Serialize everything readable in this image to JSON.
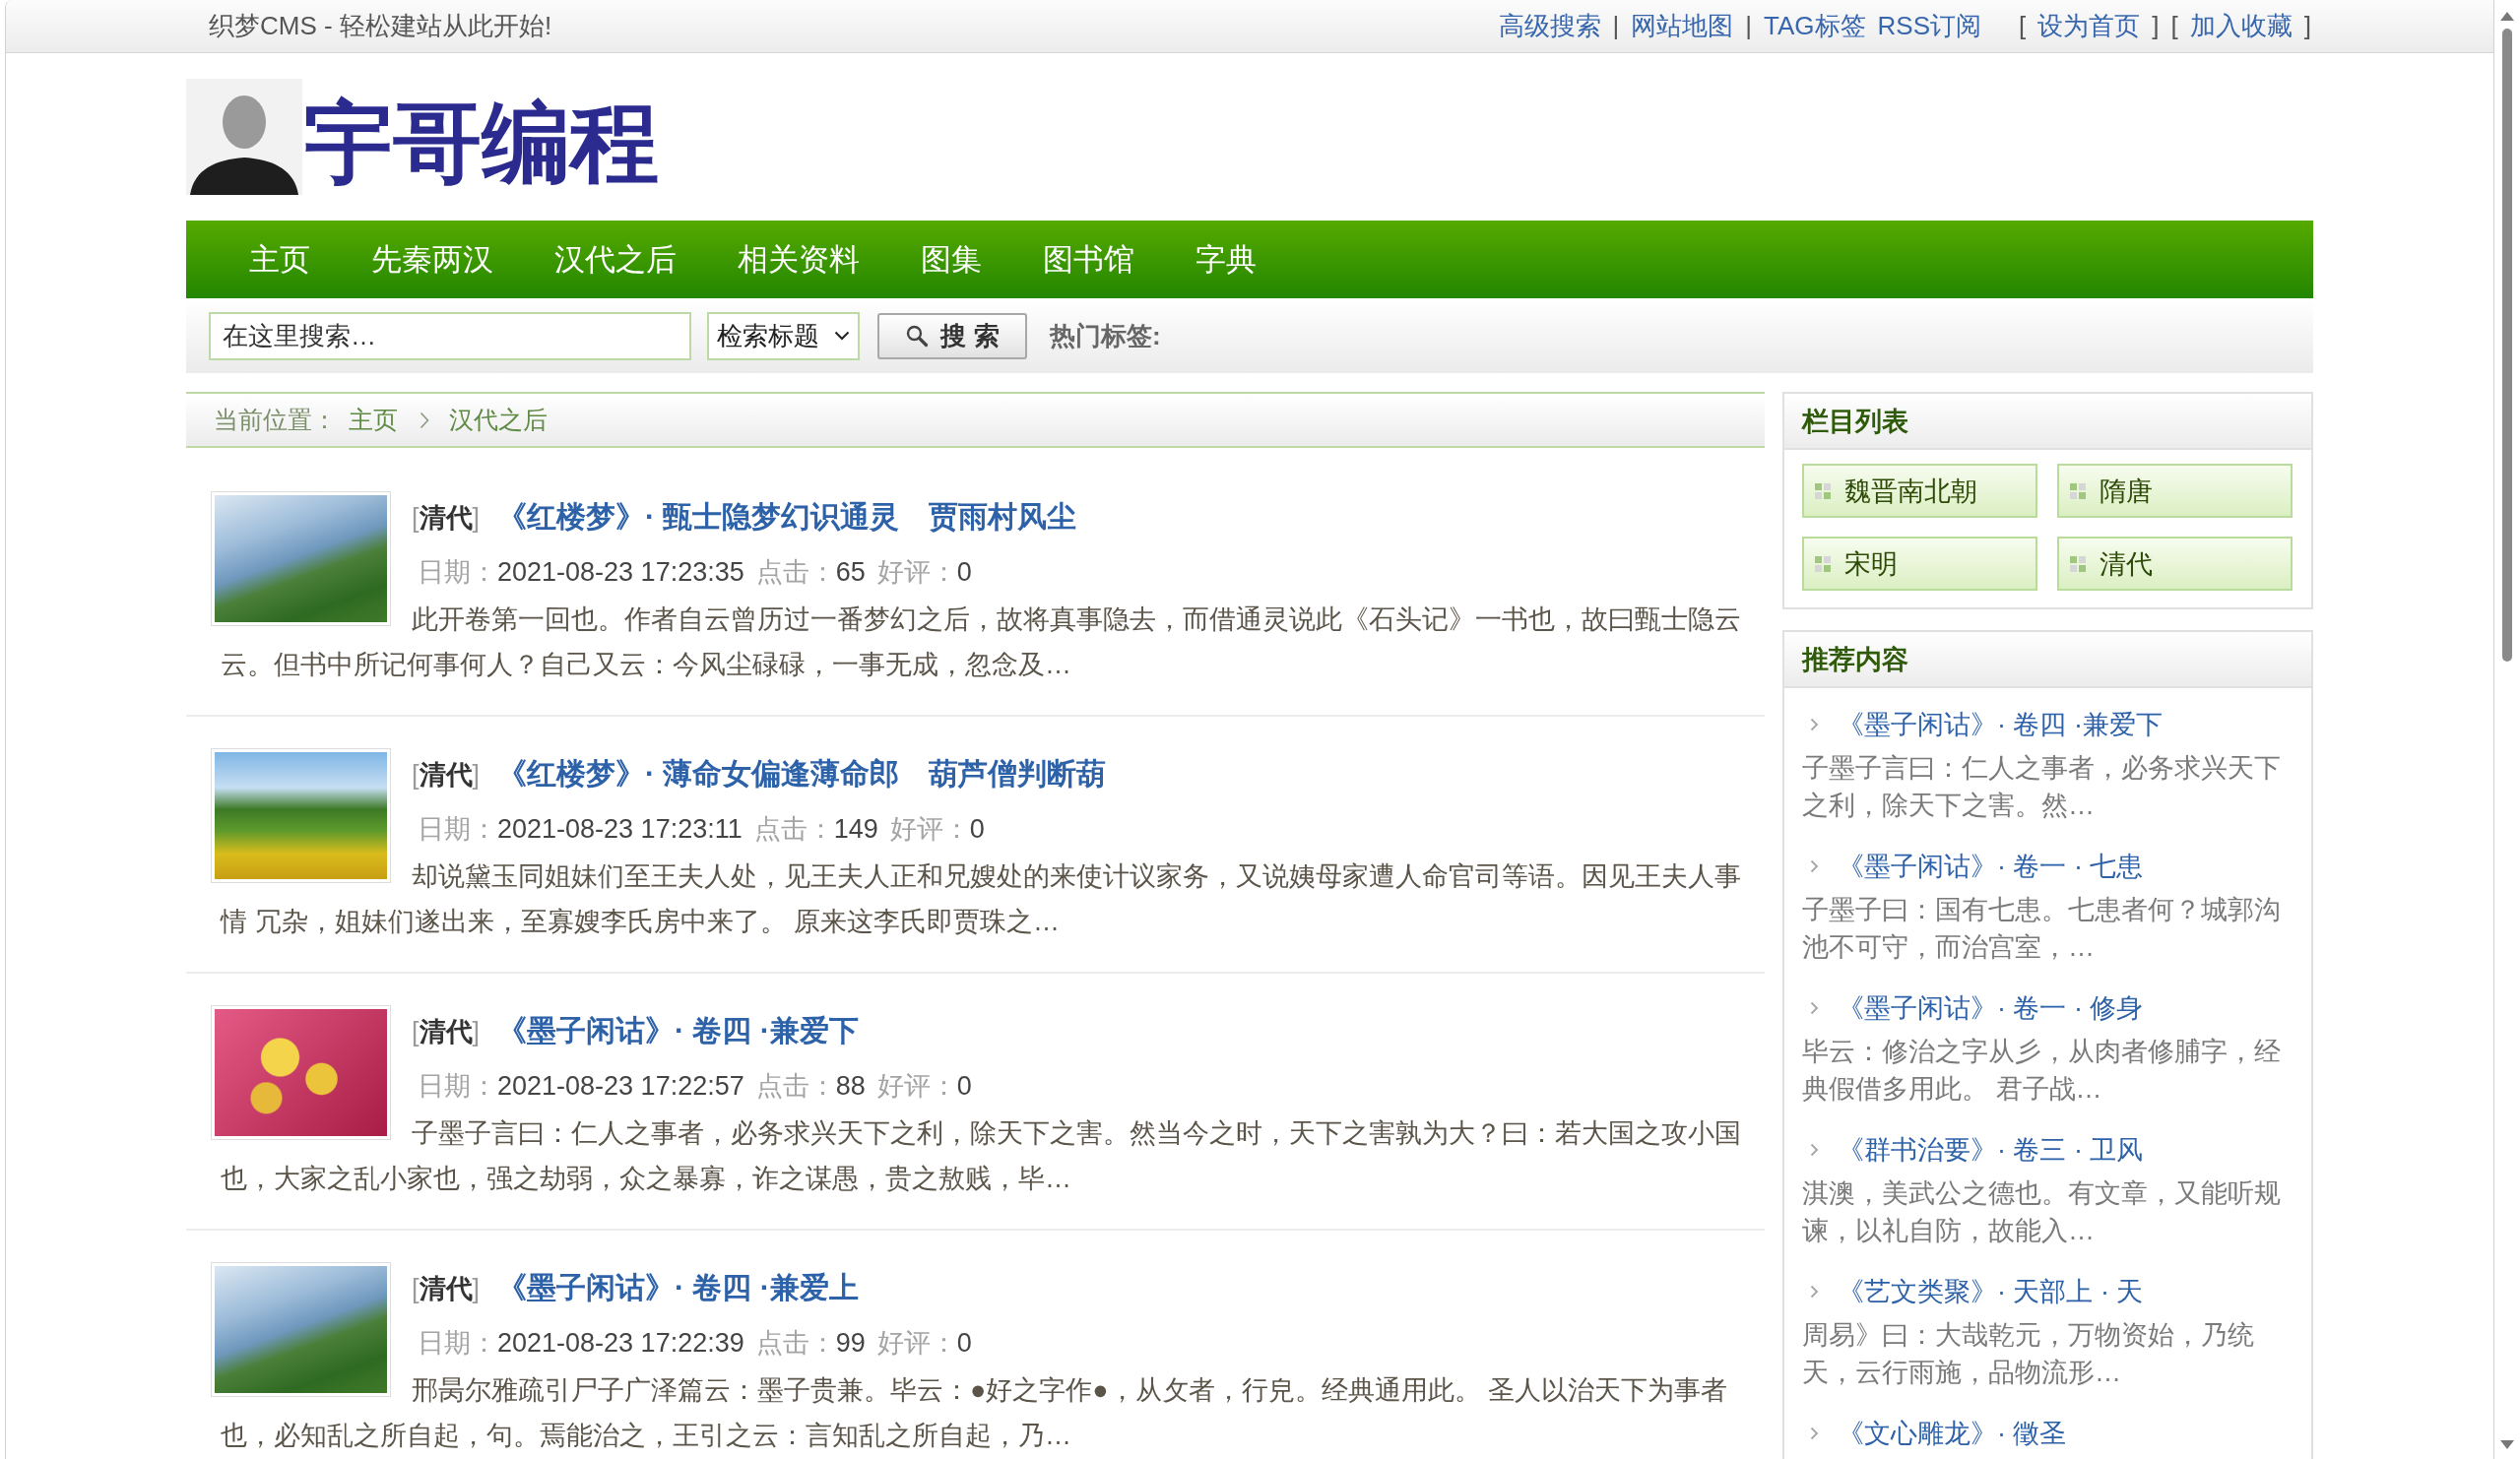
{
  "top_bar": {
    "slogan": "织梦CMS - 轻松建站从此开始!",
    "links": [
      {
        "kind": "link",
        "text": "高级搜索"
      },
      {
        "kind": "separator",
        "text": "|"
      },
      {
        "kind": "link",
        "text": "网站地图"
      },
      {
        "kind": "separator",
        "text": "|"
      },
      {
        "kind": "link",
        "text": "TAG标签"
      },
      {
        "kind": "link",
        "text": "RSS订阅"
      }
    ],
    "bookmarks": [
      {
        "kind": "separator",
        "text": "["
      },
      {
        "kind": "link",
        "text": "设为首页"
      },
      {
        "kind": "separator",
        "text": "]"
      },
      {
        "kind": "separator",
        "text": "["
      },
      {
        "kind": "link",
        "text": "加入收藏"
      },
      {
        "kind": "separator",
        "text": "]"
      }
    ]
  },
  "logo": {
    "title": "宇哥编程"
  },
  "nav": [
    {
      "label": "主页"
    },
    {
      "label": "先秦两汉"
    },
    {
      "label": "汉代之后"
    },
    {
      "label": "相关资料"
    },
    {
      "label": "图集"
    },
    {
      "label": "图书馆"
    },
    {
      "label": "字典"
    }
  ],
  "search": {
    "placeholder": "在这里搜索…",
    "scope": "检索标题",
    "button": "搜 索",
    "hot_tags_label": "热门标签:"
  },
  "breadcrumb": {
    "label": "当前位置：",
    "items": [
      {
        "text": "主页"
      },
      {
        "text": "汉代之后"
      }
    ]
  },
  "articles": [
    {
      "photo": {
        "kind": "river"
      },
      "category": "[**清代**]",
      "title": "《红楼梦》· 甄士隐梦幻识通灵　贾雨村风尘",
      "date_label": "日期：",
      "date": "2021-08-23 17:23:35",
      "clicks_label": "点击：",
      "clicks": "65",
      "rating_label": "好评：",
      "rating": "0",
      "summary": "此开卷第一回也。作者自云曾历过一番梦幻之后，故将真事隐去，而借通灵说此《石头记》一书也，故曰甄士隐云云。但书中所记何事何人？自己又云：今风尘碌碌，一事无成，忽念及…"
    },
    {
      "photo": {
        "kind": "meadow"
      },
      "category": "[**清代**]",
      "title": "《红楼梦》· 薄命女偏逢薄命郎　葫芦僧判断葫",
      "date_label": "日期：",
      "date": "2021-08-23 17:23:11",
      "clicks_label": "点击：",
      "clicks": "149",
      "rating_label": "好评：",
      "rating": "0",
      "summary": "却说黛玉同姐妹们至王夫人处，见王夫人正和兄嫂处的来使计议家务，又说姨母家遭人命官司等语。因见王夫人事情 冗杂，姐妹们遂出来，至寡嫂李氏房中来了。 原来这李氏即贾珠之…"
    },
    {
      "photo": {
        "kind": "flower"
      },
      "category": "[**清代**]",
      "title": "《墨子闲诂》· 卷四 ·兼爱下",
      "date_label": "日期：",
      "date": "2021-08-23 17:22:57",
      "clicks_label": "点击：",
      "clicks": "88",
      "rating_label": "好评：",
      "rating": "0",
      "summary": "子墨子言曰：仁人之事者，必务求兴天下之利，除天下之害。然当今之时，天下之害孰为大？曰：若大国之攻小国也，大家之乱小家也，强之劫弱，众之暴寡，诈之谋愚，贵之敖贱，毕…"
    },
    {
      "photo": {
        "kind": "river"
      },
      "category": "[**清代**]",
      "title": "《墨子闲诂》· 卷四 ·兼爱上",
      "date_label": "日期：",
      "date": "2021-08-23 17:22:39",
      "clicks_label": "点击：",
      "clicks": "99",
      "rating_label": "好评：",
      "rating": "0",
      "summary": "邢昺尔雅疏引尸子广泽篇云：墨子贵兼。毕云：●好之字作●，从攵者，行皃。经典通用此。 圣人以治天下为事者也，必知乱之所自起，句。焉能治之，王引之云：言知乱之所自起，乃…"
    }
  ],
  "sidebar": {
    "categories": {
      "title": "栏目列表",
      "items": [
        {
          "label": "魏晋南北朝"
        },
        {
          "label": "隋唐"
        },
        {
          "label": "宋明"
        },
        {
          "label": "清代"
        }
      ]
    },
    "recommended": {
      "title": "推荐内容",
      "items": [
        {
          "title": "《墨子闲诂》· 卷四 ·兼爱下",
          "summary": "子墨子言曰：仁人之事者，必务求兴天下之利，除天下之害。然…"
        },
        {
          "title": "《墨子闲诂》· 卷一 · 七患",
          "summary": "子墨子曰：国有七患。七患者何？城郭沟池不可守，而治宫室，…"
        },
        {
          "title": "《墨子闲诂》· 卷一 · 修身",
          "summary": "毕云：修治之字从彡，从肉者修脯字，经典假借多用此。 君子战…"
        },
        {
          "title": "《群书治要》· 卷三 · 卫风",
          "summary": "淇澳，美武公之德也。有文章，又能听规谏，以礼自防，故能入…"
        },
        {
          "title": "《艺文类聚》· 天部上 · 天",
          "summary": "周易》曰：大哉乾元，万物资始，乃统天，云行雨施，品物流形…"
        },
        {
          "title": "《文心雕龙》· 徵圣"
        }
      ]
    }
  }
}
